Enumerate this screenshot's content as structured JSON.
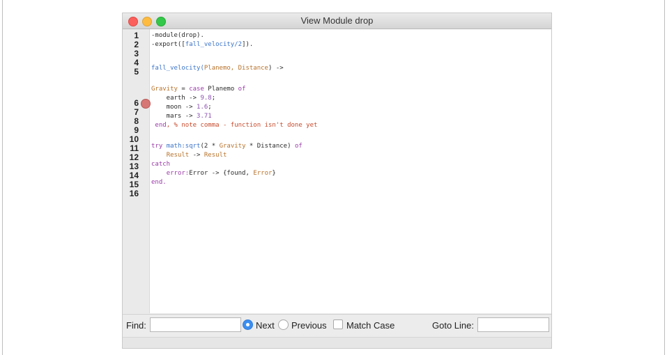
{
  "window": {
    "title": "View Module drop"
  },
  "gutter": {
    "lines": [
      "1",
      "2",
      "3",
      "4",
      "5",
      "6",
      "7",
      "8",
      "9",
      "10",
      "11",
      "12",
      "13",
      "14",
      "15",
      "16"
    ]
  },
  "code": {
    "line1": "-module(drop).",
    "line2_pre": "-export([",
    "line2_fn": "fall_velocity/2",
    "line2_post": "]).",
    "line4_fn": "fall_velocity(",
    "line4_args": "Planemo, Distance",
    "line4_post": ") ->",
    "line6_var": "Gravity",
    "line6_mid": " = ",
    "line6_kw": "case",
    "line6_arg": " Planemo ",
    "line6_of": "of",
    "line7_pre": "    earth -> ",
    "line7_num": "9.8",
    "line7_post": ";",
    "line8_pre": "    moon -> ",
    "line8_num": "1.6",
    "line8_post": ";",
    "line9_pre": "    mars -> ",
    "line9_num": "3.71",
    "line10_end": " end",
    "line10_comment": ", % note comma - function isn't done yet",
    "line12_try": "try ",
    "line12_fn": "math:sqrt",
    "line12_a": "(2 * ",
    "line12_v1": "Gravity",
    "line12_b": " * Distance) ",
    "line12_of": "of",
    "line13_pre": "    ",
    "line13_a": "Result",
    "line13_mid": " -> ",
    "line13_b": "Result",
    "line14": "catch",
    "line15_pre": "    ",
    "line15_kw": "error:",
    "line15_mid": "Error -> {found, ",
    "line15_var": "Error",
    "line15_post": "}",
    "line16": "end."
  },
  "findbar": {
    "find_label": "Find:",
    "find_value": "",
    "next_label": "Next",
    "previous_label": "Previous",
    "match_case_label": "Match Case",
    "goto_label": "Goto Line:",
    "goto_value": "",
    "selected_direction": "Next",
    "match_case_checked": false
  }
}
